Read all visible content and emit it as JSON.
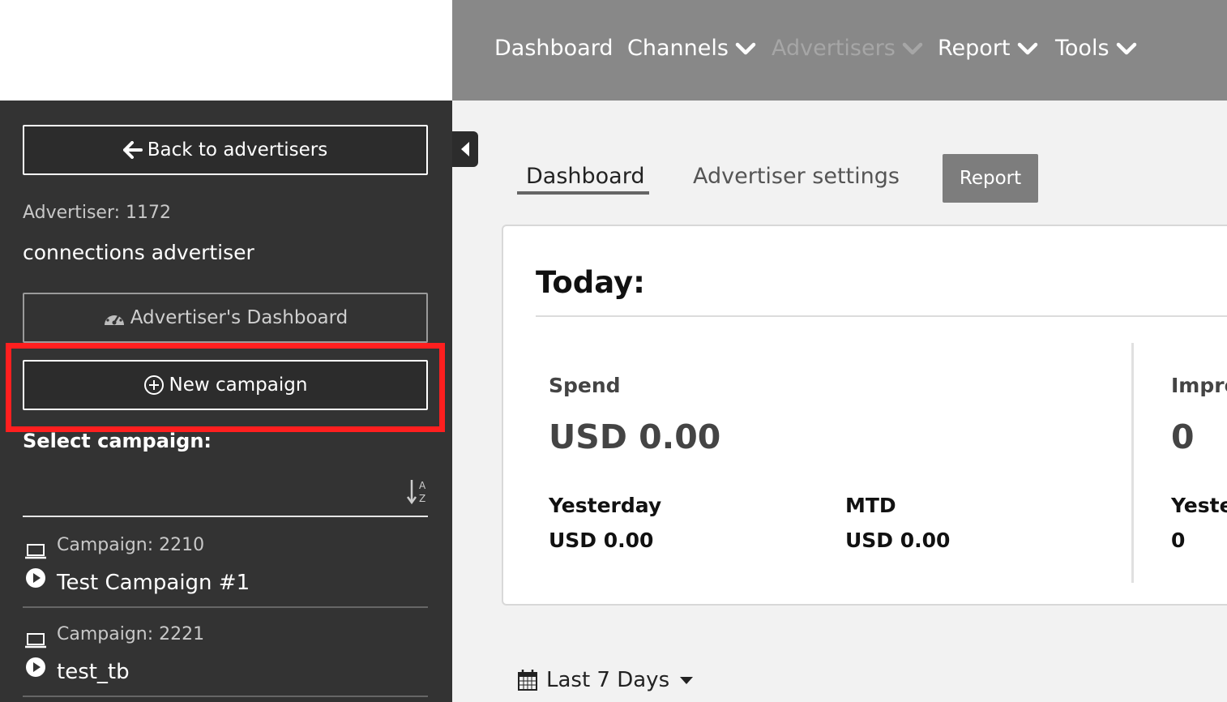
{
  "topnav": {
    "items": [
      {
        "label": "Dashboard"
      },
      {
        "label": "Channels"
      },
      {
        "label": "Advertisers"
      },
      {
        "label": "Report"
      },
      {
        "label": "Tools"
      }
    ]
  },
  "sidebar": {
    "back_label": "Back to advertisers",
    "advertiser_id": "Advertiser: 1172",
    "advertiser_name": "connections advertiser",
    "dashboard_label": "Advertiser's Dashboard",
    "new_campaign_label": "New campaign",
    "select_campaign_label": "Select campaign:",
    "campaigns": [
      {
        "id": "Campaign: 2210",
        "name": "Test Campaign #1"
      },
      {
        "id": "Campaign: 2221",
        "name": "test_tb"
      }
    ]
  },
  "tabs": [
    {
      "label": "Dashboard"
    },
    {
      "label": "Advertiser settings"
    }
  ],
  "report_button": "Report",
  "card": {
    "title": "Today:",
    "spend": {
      "label": "Spend",
      "value": "USD 0.00",
      "yesterday_label": "Yesterday",
      "yesterday_value": "USD 0.00",
      "mtd_label": "MTD",
      "mtd_value": "USD 0.00"
    },
    "impressions": {
      "label": "Impre",
      "value": "0",
      "yesterday_label": "Yeste",
      "yesterday_value": "0"
    }
  },
  "date_range": {
    "label": "Last 7 Days"
  },
  "colors": {
    "topnav_bg": "#888888",
    "sidebar_bg": "#333333",
    "highlight": "#ff1f1f",
    "report_btn": "#7d7d7d"
  }
}
